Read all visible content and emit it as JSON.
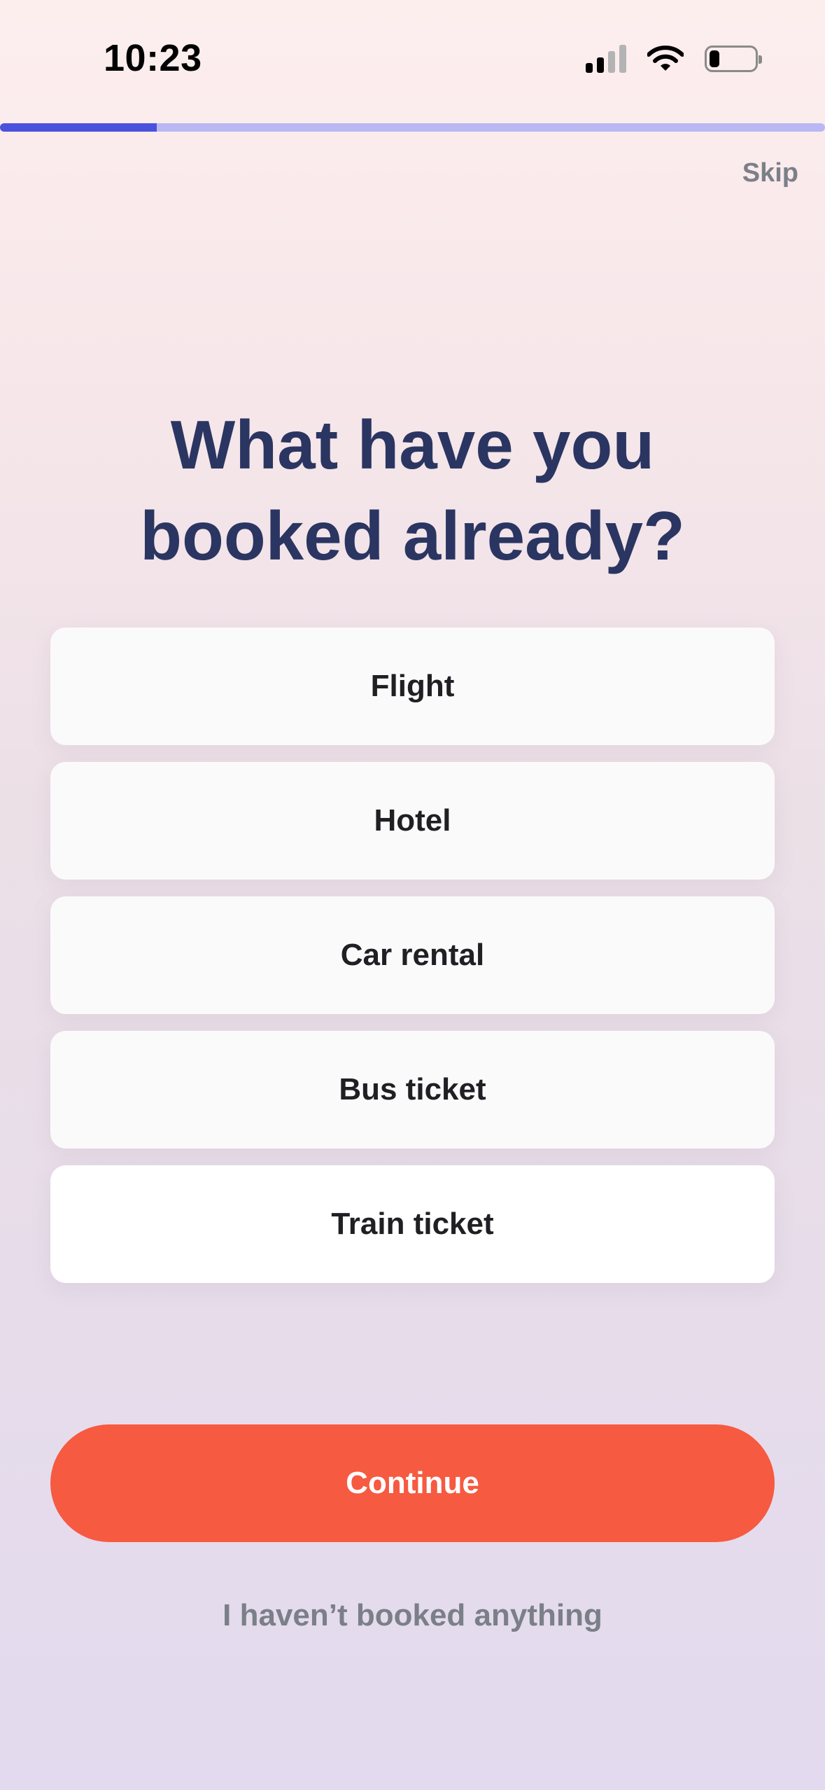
{
  "status_bar": {
    "time": "10:23",
    "signal_icon": "cellular-signal-icon",
    "wifi_icon": "wifi-icon",
    "battery_icon": "battery-low-icon"
  },
  "progress": {
    "fraction": 0.19,
    "fill_color": "#4a52dd",
    "track_color": "#b9b8f3"
  },
  "header": {
    "skip_label": "Skip"
  },
  "question": {
    "line1": "What have you",
    "line2": "booked already?"
  },
  "options": [
    {
      "label": "Flight"
    },
    {
      "label": "Hotel"
    },
    {
      "label": "Car rental"
    },
    {
      "label": "Bus ticket"
    },
    {
      "label": "Train ticket"
    }
  ],
  "actions": {
    "continue_label": "Continue",
    "continue_color": "#f65a41",
    "none_label": "I haven’t booked anything"
  }
}
